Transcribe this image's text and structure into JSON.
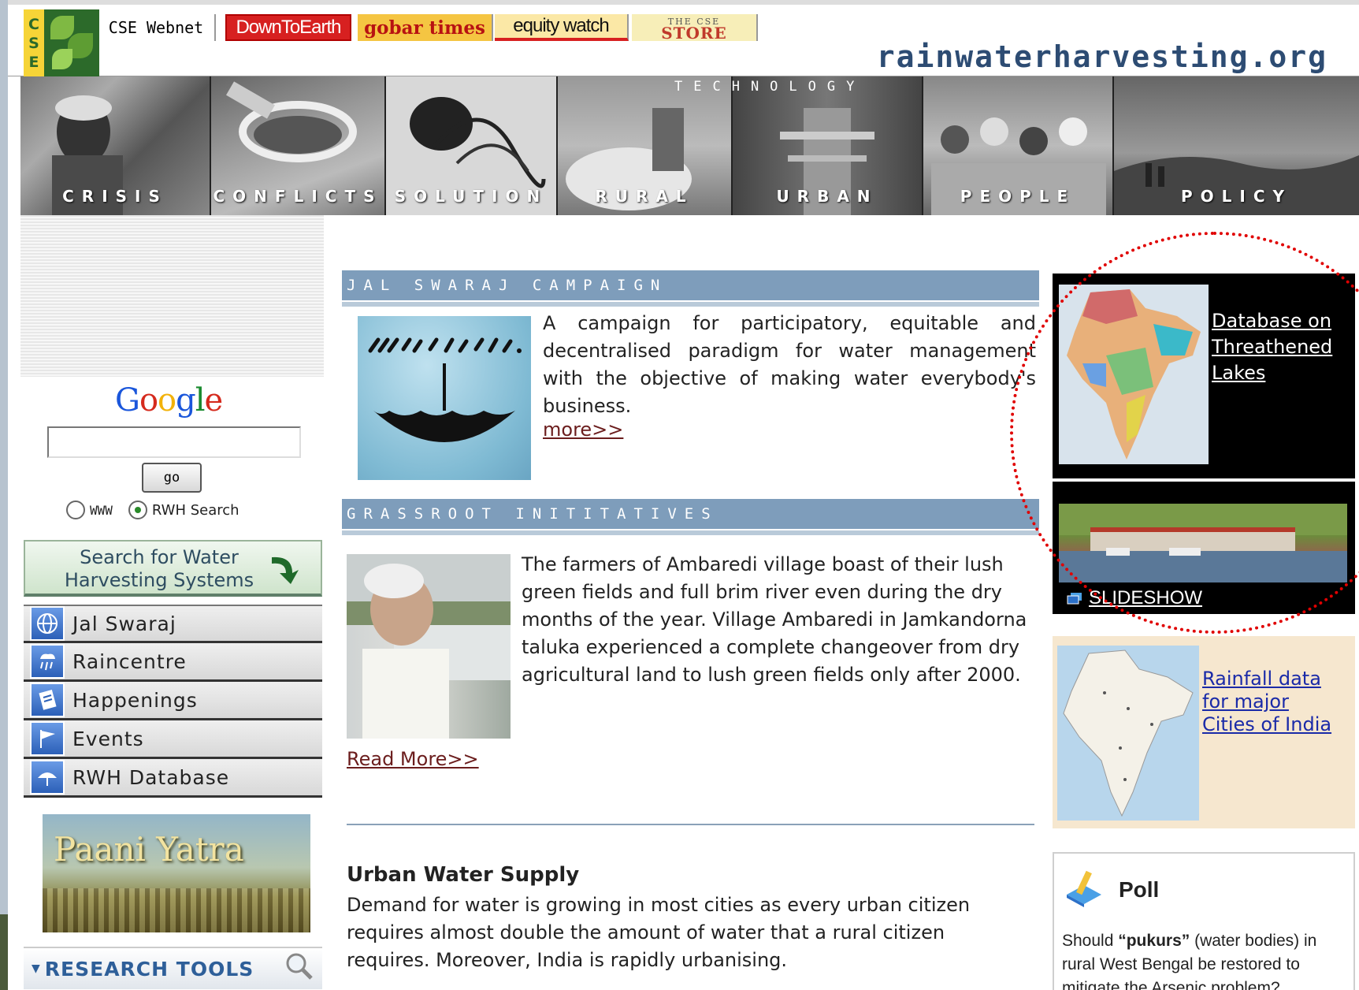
{
  "header": {
    "logo_letters": [
      "C",
      "S",
      "E"
    ],
    "links": {
      "webnet": "CSE Webnet",
      "down_to_earth": "DownToEarth",
      "gobar_times": "gobar times",
      "equity_watch": "equity watch",
      "store_the": "THE CSE",
      "store_name": "STORE"
    },
    "site_name": "rainwaterharvesting.org"
  },
  "banner": {
    "technology_label": "TECHNOLOGY",
    "sections": [
      "CRISIS",
      "CONFLICTS",
      "SOLUTION",
      "RURAL",
      "URBAN",
      "PEOPLE",
      "POLICY"
    ]
  },
  "sidebar": {
    "google": {
      "letters": [
        "G",
        "o",
        "o",
        "g",
        "l",
        "e"
      ],
      "search_value": "",
      "go_label": "go",
      "radio_www": "WWW",
      "radio_rwh": "RWH Search",
      "selected": "RWH Search"
    },
    "search_water": {
      "line1": "Search for Water",
      "line2": "Harvesting Systems"
    },
    "nav": [
      "Jal Swaraj",
      "Raincentre",
      "Happenings",
      "Events",
      "RWH Database"
    ],
    "paani_yatra": "Paani Yatra",
    "research_tools": "RESEARCH TOOLS"
  },
  "main": {
    "jal_swaraj": {
      "heading": "JAL SWARAJ CAMPAIGN",
      "text": "A campaign for participatory, equitable and decentralised paradigm for water management with the objective of making water everybody's business.",
      "more": "more>>"
    },
    "grassroot": {
      "heading": "GRASSROOT INITITATIVES",
      "text": "The farmers of Ambaredi village boast of their lush green fields and full brim river even during the dry months of the year. Village Ambaredi in Jamkandorna taluka experienced a complete changeover from dry agricultural land to lush green fields only after 2000.",
      "more": "Read More>>"
    },
    "urban": {
      "title": "Urban Water Supply",
      "text": "Demand for water is growing in most cities as every urban citizen requires almost double the amount of water that a rural citizen requires. Moreover, India is rapidly urbanising."
    }
  },
  "right": {
    "lakes_link": [
      "Database on",
      "Threathened",
      "Lakes"
    ],
    "slideshow": "SLIDESHOW",
    "rainfall_link": [
      "Rainfall data",
      "for major",
      "Cities of India"
    ],
    "poll": {
      "title": "Poll",
      "question_pre": "Should ",
      "question_bold": "“pukurs”",
      "question_post": " (water bodies) in rural West Bengal be restored to mitigate the Arsenic problem?"
    }
  },
  "colors": {
    "accent_blue": "#7e9dbb",
    "site_name": "#2d4c73",
    "annotation_red": "#e00000",
    "link_maroon": "#6b1d1d"
  }
}
